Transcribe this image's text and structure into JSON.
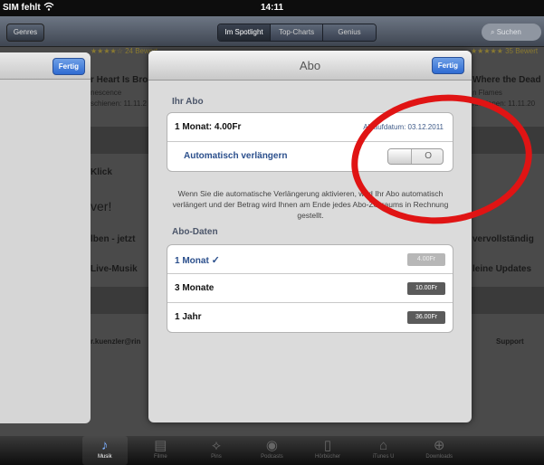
{
  "status_bar": {
    "carrier": "SIM fehlt",
    "time": "14:11"
  },
  "store_nav": {
    "genres_label": "Genres",
    "segments": [
      "Im Spotlight",
      "Top-Charts",
      "Genius"
    ],
    "search_placeholder": "Suchen"
  },
  "background": {
    "rating_left": "24 Bewert",
    "rating_right": "35 Bewert",
    "album_left_title": "r Heart Is Bro",
    "album_left_artist": "nescence",
    "album_left_date": "schienen: 11.11.2",
    "album_right_title": "Where the Dead",
    "album_right_artist": "n Flames",
    "album_right_date": "rschienen: 11.11.20",
    "klick": "Klick",
    "ver": "ver!",
    "lben": "lben - jetzt",
    "live": "Live-Musik",
    "vervoll": "vervollständig",
    "updates": "leine Updates",
    "email": "r.kuenzler@rin",
    "support": "Support"
  },
  "left_sheet": {
    "done_label": "Fertig"
  },
  "sheet": {
    "title": "Abo",
    "done_label": "Fertig",
    "your_sub_label": "Ihr Abo",
    "current_plan": "1 Monat: 4.00Fr",
    "end_date": "Ablaufdatum: 03.12.2011",
    "auto_renew_label": "Automatisch verlängern",
    "auto_renew_state": "O",
    "note": "Wenn Sie die automatische Verlängerung aktivieren, wird Ihr Abo automatisch verlängert und der Betrag wird Ihnen am Ende jedes Abo-Zeitraums in Rechnung gestellt.",
    "plans_label": "Abo-Daten",
    "plans": [
      {
        "name": "1 Monat",
        "price": "4.00Fr",
        "selected": true,
        "check": "✓"
      },
      {
        "name": "3 Monate",
        "price": "10.00Fr",
        "selected": false
      },
      {
        "name": "1 Jahr",
        "price": "36.00Fr",
        "selected": false
      }
    ]
  },
  "tab_bar": {
    "tabs": [
      {
        "label": "Musik",
        "icon": "music-note-icon"
      },
      {
        "label": "Filme",
        "icon": "film-icon"
      },
      {
        "label": "Pins",
        "icon": "ping-icon"
      },
      {
        "label": "Podcasts",
        "icon": "podcast-icon"
      },
      {
        "label": "Hörbücher",
        "icon": "audiobook-icon"
      },
      {
        "label": "iTunes U",
        "icon": "graduation-cap-icon"
      },
      {
        "label": "Downloads",
        "icon": "download-icon"
      }
    ]
  },
  "colors": {
    "annotation": "#e01414",
    "accent_blue": "#2f6bd2"
  }
}
